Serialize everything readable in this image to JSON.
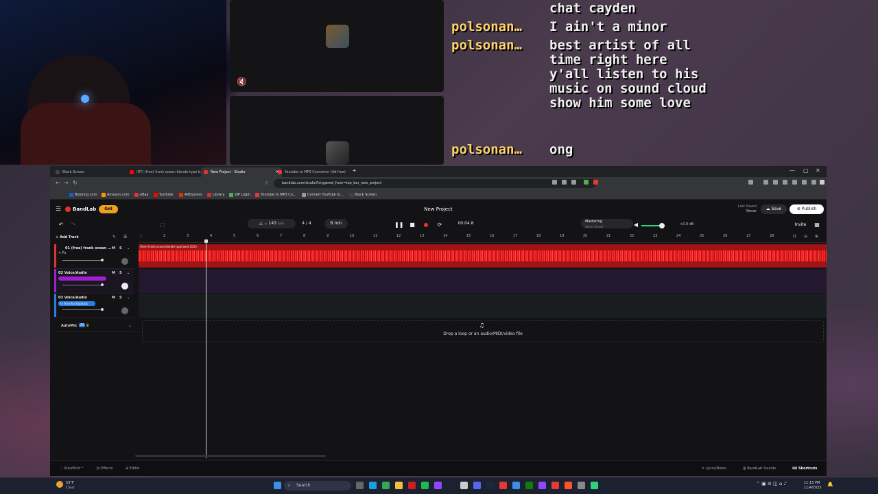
{
  "chat": {
    "messages": [
      {
        "user": "",
        "text": "chat cayden"
      },
      {
        "user": "polsonan…",
        "text": "I ain't a minor"
      },
      {
        "user": "polsonan…",
        "text": "best artist of all time right here y'all listen to his music on sound cloud show him some love"
      },
      {
        "user": "polsonan…",
        "text": "ong"
      }
    ]
  },
  "browser": {
    "tabs": [
      {
        "label": "Black Screen",
        "color": "#444444"
      },
      {
        "label": "(87) (free) frank ocean blonde type b...",
        "color": "#ff0000"
      },
      {
        "label": "New Project - Studio",
        "color": "#e5332a"
      },
      {
        "label": "Youtube to MP3 Converter (Ad-free)",
        "color": "#e53935"
      }
    ],
    "url": "bandlab.com/studio?triggered_from=top_bar_new_project",
    "bookmarks": [
      {
        "label": "Booking.com",
        "color": "#1e5bc6"
      },
      {
        "label": "Amazon.com",
        "color": "#ff9900"
      },
      {
        "label": "eBay",
        "color": "#e53238"
      },
      {
        "label": "YouTube",
        "color": "#ff0000"
      },
      {
        "label": "AliExpress",
        "color": "#e62e04"
      },
      {
        "label": "Library",
        "color": "#cc3333"
      },
      {
        "label": "VIP Login",
        "color": "#4caf50"
      },
      {
        "label": "Youtube to MP3 Co...",
        "color": "#e53935"
      },
      {
        "label": "Convert YouTube to...",
        "color": "#999999"
      },
      {
        "label": "Black Screen",
        "color": "#444444"
      }
    ]
  },
  "studio": {
    "brand": "BandLab",
    "get_label": "Get",
    "project_title": "New Project",
    "last_saved_label": "Last Saved",
    "last_saved_value": "Never",
    "save_label": "Save",
    "publish_label": "Publish",
    "invite_label": "Invite",
    "bpm": "143",
    "bpm_unit": "bpm",
    "time_signature": "4 / 4",
    "key": "B min",
    "time": "00:04.8",
    "mastering_label": "Mastering",
    "mastering_sub": "Select Preset",
    "volume_db": "+0.0 dB",
    "add_track_label": "Add Track",
    "ruler": [
      "1",
      "2",
      "3",
      "4",
      "5",
      "6",
      "7",
      "8",
      "9",
      "10",
      "11",
      "12",
      "13",
      "14",
      "15",
      "16",
      "17",
      "18",
      "19",
      "20",
      "21",
      "22",
      "23",
      "24",
      "25",
      "26",
      "27",
      "28"
    ],
    "tracks": [
      {
        "name": "01 (free) frank ocean ...",
        "sub": "+ Fx",
        "color": "#e5332a",
        "clip": "(free) frank ocean blonde type beat 2023"
      },
      {
        "name": "02 Voice/Audio",
        "sub": "",
        "color": "#a020d0",
        "clip": ""
      },
      {
        "name": "03 Voice/Audio",
        "sub": "Fx Voiceful Slapback",
        "color": "#2a7de1",
        "clip": ""
      }
    ],
    "automix_label": "AutoMix",
    "automix_badge": "AI",
    "drop_text": "Drop a loop or an audio/MIDI/video file",
    "footer_left": [
      "AutoPitch™",
      "Effects",
      "Editor"
    ],
    "footer_right": [
      "Lyrics/Notes",
      "BandLab Sounds",
      "Shortcuts"
    ]
  },
  "taskbar": {
    "weather_temp": "53°F",
    "weather_desc": "Clear",
    "search_label": "Search",
    "time": "11:15 PM",
    "date": "11/4/2025"
  }
}
